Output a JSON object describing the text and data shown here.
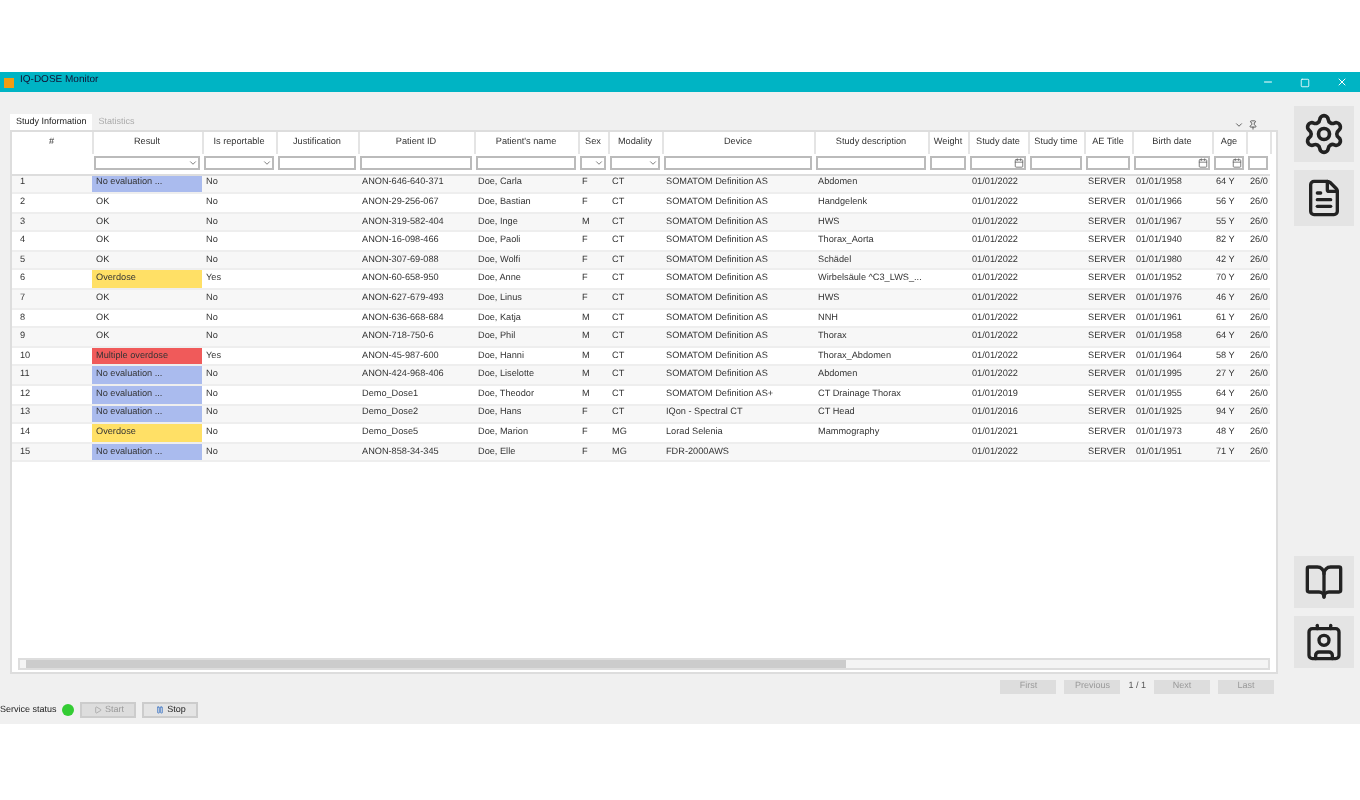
{
  "window": {
    "title": "IQ-DOSE Monitor"
  },
  "tabs": [
    {
      "label": "Study Information",
      "selected": true
    },
    {
      "label": "Statistics",
      "selected": false
    }
  ],
  "table": {
    "columns": [
      {
        "label": "#"
      },
      {
        "label": "Result",
        "kind": "dropdown"
      },
      {
        "label": "Is reportable",
        "kind": "dropdown"
      },
      {
        "label": "Justification",
        "kind": "text"
      },
      {
        "label": "Patient ID",
        "kind": "text"
      },
      {
        "label": "Patient's name",
        "kind": "text"
      },
      {
        "label": "Sex",
        "kind": "dropdown"
      },
      {
        "label": "Modality",
        "kind": "dropdown"
      },
      {
        "label": "Device",
        "kind": "text"
      },
      {
        "label": "Study description",
        "kind": "text"
      },
      {
        "label": "Weight",
        "kind": "text"
      },
      {
        "label": "Study date",
        "kind": "date"
      },
      {
        "label": "Study time",
        "kind": "text"
      },
      {
        "label": "AE Title",
        "kind": "text"
      },
      {
        "label": "Birth date",
        "kind": "date"
      },
      {
        "label": "Age",
        "kind": "date"
      },
      {
        "kind": "text"
      }
    ],
    "rows": [
      {
        "number": "1",
        "result": {
          "text": "No evaluation ...",
          "color": "#aabbee"
        },
        "is_reportable": "No",
        "patient_id": "ANON-646-640-371",
        "patients_name": "Doe, Carla",
        "sex": "F",
        "modality": "CT",
        "device": "SOMATOM Definition AS",
        "study_description": "Abdomen",
        "study_date": "01/01/2022",
        "ae_title": "SERVER",
        "birth_date": "01/01/1958",
        "age": "64 Y",
        "column_17": "26/0"
      },
      {
        "number": "2",
        "result": {
          "text": "OK"
        },
        "is_reportable": "No",
        "patient_id": "ANON-29-256-067",
        "patients_name": "Doe, Bastian",
        "sex": "F",
        "modality": "CT",
        "device": "SOMATOM Definition AS",
        "study_description": "Handgelenk",
        "study_date": "01/01/2022",
        "ae_title": "SERVER",
        "birth_date": "01/01/1966",
        "age": "56 Y",
        "column_17": "26/0"
      },
      {
        "number": "3",
        "result": {
          "text": "OK"
        },
        "is_reportable": "No",
        "patient_id": "ANON-319-582-404",
        "patients_name": "Doe, Inge",
        "sex": "M",
        "modality": "CT",
        "device": "SOMATOM Definition AS",
        "study_description": "HWS",
        "study_date": "01/01/2022",
        "ae_title": "SERVER",
        "birth_date": "01/01/1967",
        "age": "55 Y",
        "column_17": "26/0"
      },
      {
        "number": "4",
        "result": {
          "text": "OK"
        },
        "is_reportable": "No",
        "patient_id": "ANON-16-098-466",
        "patients_name": "Doe, Paoli",
        "sex": "F",
        "modality": "CT",
        "device": "SOMATOM Definition AS",
        "study_description": "Thorax_Aorta",
        "study_date": "01/01/2022",
        "ae_title": "SERVER",
        "birth_date": "01/01/1940",
        "age": "82 Y",
        "column_17": "26/0"
      },
      {
        "number": "5",
        "result": {
          "text": "OK"
        },
        "is_reportable": "No",
        "patient_id": "ANON-307-69-088",
        "patients_name": "Doe, Wolfi",
        "sex": "F",
        "modality": "CT",
        "device": "SOMATOM Definition AS",
        "study_description": "Schädel",
        "study_date": "01/01/2022",
        "ae_title": "SERVER",
        "birth_date": "01/01/1980",
        "age": "42 Y",
        "column_17": "26/0"
      },
      {
        "number": "6",
        "result": {
          "text": "Overdose",
          "color": "#ffe066"
        },
        "is_reportable": "Yes",
        "patient_id": "ANON-60-658-950",
        "patients_name": "Doe, Anne",
        "sex": "F",
        "modality": "CT",
        "device": "SOMATOM Definition AS",
        "study_description": "Wirbelsäule ^C3_LWS_...",
        "study_date": "01/01/2022",
        "ae_title": "SERVER",
        "birth_date": "01/01/1952",
        "age": "70 Y",
        "column_17": "26/0"
      },
      {
        "number": "7",
        "result": {
          "text": "OK"
        },
        "is_reportable": "No",
        "patient_id": "ANON-627-679-493",
        "patients_name": "Doe, Linus",
        "sex": "F",
        "modality": "CT",
        "device": "SOMATOM Definition AS",
        "study_description": "HWS",
        "study_date": "01/01/2022",
        "ae_title": "SERVER",
        "birth_date": "01/01/1976",
        "age": "46 Y",
        "column_17": "26/0"
      },
      {
        "number": "8",
        "result": {
          "text": "OK"
        },
        "is_reportable": "No",
        "patient_id": "ANON-636-668-684",
        "patients_name": "Doe, Katja",
        "sex": "M",
        "modality": "CT",
        "device": "SOMATOM Definition AS",
        "study_description": "NNH",
        "study_date": "01/01/2022",
        "ae_title": "SERVER",
        "birth_date": "01/01/1961",
        "age": "61 Y",
        "column_17": "26/0"
      },
      {
        "number": "9",
        "result": {
          "text": "OK"
        },
        "is_reportable": "No",
        "patient_id": "ANON-718-750-6",
        "patients_name": "Doe, Phil",
        "sex": "M",
        "modality": "CT",
        "device": "SOMATOM Definition AS",
        "study_description": "Thorax",
        "study_date": "01/01/2022",
        "ae_title": "SERVER",
        "birth_date": "01/01/1958",
        "age": "64 Y",
        "column_17": "26/0"
      },
      {
        "number": "10",
        "result": {
          "text": "Multiple overdose",
          "color": "#f05a5a"
        },
        "is_reportable": "Yes",
        "patient_id": "ANON-45-987-600",
        "patients_name": "Doe, Hanni",
        "sex": "M",
        "modality": "CT",
        "device": "SOMATOM Definition AS",
        "study_description": "Thorax_Abdomen",
        "study_date": "01/01/2022",
        "ae_title": "SERVER",
        "birth_date": "01/01/1964",
        "age": "58 Y",
        "column_17": "26/0"
      },
      {
        "number": "11",
        "result": {
          "text": "No evaluation ...",
          "color": "#aabbee"
        },
        "is_reportable": "No",
        "patient_id": "ANON-424-968-406",
        "patients_name": "Doe, Liselotte",
        "sex": "M",
        "modality": "CT",
        "device": "SOMATOM Definition AS",
        "study_description": "Abdomen",
        "study_date": "01/01/2022",
        "ae_title": "SERVER",
        "birth_date": "01/01/1995",
        "age": "27 Y",
        "column_17": "26/0"
      },
      {
        "number": "12",
        "result": {
          "text": "No evaluation ...",
          "color": "#aabbee"
        },
        "is_reportable": "No",
        "patient_id": "Demo_Dose1",
        "patients_name": "Doe, Theodor",
        "sex": "M",
        "modality": "CT",
        "device": "SOMATOM Definition AS+",
        "study_description": "CT Drainage Thorax",
        "study_date": "01/01/2019",
        "ae_title": "SERVER",
        "birth_date": "01/01/1955",
        "age": "64 Y",
        "column_17": "26/0"
      },
      {
        "number": "13",
        "result": {
          "text": "No evaluation ...",
          "color": "#aabbee"
        },
        "is_reportable": "No",
        "patient_id": "Demo_Dose2",
        "patients_name": "Doe, Hans",
        "sex": "F",
        "modality": "CT",
        "device": "IQon - Spectral CT",
        "study_description": "CT Head",
        "study_date": "01/01/2016",
        "ae_title": "SERVER",
        "birth_date": "01/01/1925",
        "age": "94 Y",
        "column_17": "26/0"
      },
      {
        "number": "14",
        "result": {
          "text": "Overdose",
          "color": "#ffe066"
        },
        "is_reportable": "No",
        "patient_id": "Demo_Dose5",
        "patients_name": "Doe, Marion",
        "sex": "F",
        "modality": "MG",
        "device": "Lorad Selenia",
        "study_description": "Mammography",
        "study_date": "01/01/2021",
        "ae_title": "SERVER",
        "birth_date": "01/01/1973",
        "age": "48 Y",
        "column_17": "26/0"
      },
      {
        "number": "15",
        "result": {
          "text": "No evaluation ...",
          "color": "#aabbee"
        },
        "is_reportable": "No",
        "patient_id": "ANON-858-34-345",
        "patients_name": "Doe, Elle",
        "sex": "F",
        "modality": "MG",
        "device": "FDR-2000AWS",
        "study_date": "01/01/2022",
        "ae_title": "SERVER",
        "birth_date": "01/01/1951",
        "age": "71 Y",
        "column_17": "26/0"
      }
    ]
  },
  "pagination": {
    "buttons": [
      {
        "label": "First",
        "disabled": true
      },
      {
        "label": "Previous",
        "disabled": true
      },
      {
        "label": "Next",
        "disabled": true
      },
      {
        "label": "Last",
        "disabled": true
      }
    ],
    "page": "1 / 1"
  },
  "status": {
    "label": "Service status",
    "running": true,
    "buttons": [
      {
        "label": "Start",
        "disabled": true
      },
      {
        "label": "Stop",
        "disabled": false
      }
    ]
  }
}
